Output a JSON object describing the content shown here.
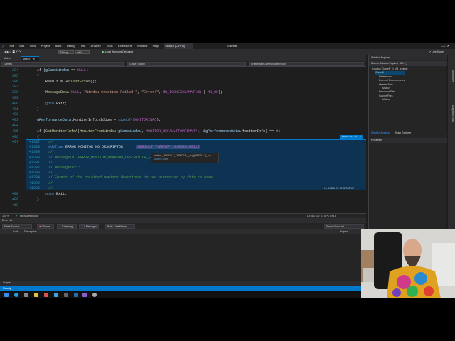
{
  "menu": {
    "items": [
      "File",
      "Edit",
      "View",
      "Project",
      "Build",
      "Debug",
      "Test",
      "Analyze",
      "Tools",
      "Extensions",
      "Window",
      "Help"
    ],
    "search": "Search (Ctrl+Q)",
    "solution_name": "GameB",
    "live_share": "Live Share"
  },
  "toolbar": {
    "config": "Debug",
    "platform": "x64",
    "debugger": "Local Windows Debugger"
  },
  "tabs": [
    {
      "label": "Main.h"
    },
    {
      "label": "Main.c"
    }
  ],
  "navbar": {
    "project": "GameB",
    "scope": "(Global Scope)",
    "function": "CreateMainGameWindow(void)"
  },
  "code_lines": [
    {
      "num": "394",
      "parts": [
        {
          "t": "if (",
          "c": ""
        },
        {
          "t": "gGameWindow",
          "c": "var"
        },
        {
          "t": " == ",
          "c": ""
        },
        {
          "t": "NULL",
          "c": "mac"
        },
        {
          "t": ")",
          "c": ""
        }
      ],
      "indent": 0
    },
    {
      "num": "395",
      "parts": [
        {
          "t": "{",
          "c": ""
        }
      ],
      "indent": 0
    },
    {
      "num": "396",
      "parts": [
        {
          "t": "Result = ",
          "c": ""
        },
        {
          "t": "GetLastError",
          "c": "fn"
        },
        {
          "t": "();",
          "c": ""
        }
      ],
      "indent": 1
    },
    {
      "num": "397",
      "parts": [],
      "indent": 1
    },
    {
      "num": "398",
      "parts": [
        {
          "t": "MessageBoxA",
          "c": "fn"
        },
        {
          "t": "(",
          "c": ""
        },
        {
          "t": "NULL",
          "c": "mac"
        },
        {
          "t": ", ",
          "c": ""
        },
        {
          "t": "\"Window Creation Failed!\"",
          "c": "str"
        },
        {
          "t": ", ",
          "c": ""
        },
        {
          "t": "\"Error!\"",
          "c": "str"
        },
        {
          "t": ", ",
          "c": ""
        },
        {
          "t": "MB_ICONEXCLAMATION",
          "c": "mac"
        },
        {
          "t": " | ",
          "c": ""
        },
        {
          "t": "MB_OK",
          "c": "mac"
        },
        {
          "t": ");",
          "c": ""
        }
      ],
      "indent": 1
    },
    {
      "num": "399",
      "parts": [],
      "indent": 1
    },
    {
      "num": "400",
      "parts": [
        {
          "t": "goto",
          "c": "kw"
        },
        {
          "t": " Exit;",
          "c": ""
        }
      ],
      "indent": 1
    },
    {
      "num": "401",
      "parts": [
        {
          "t": "}",
          "c": ""
        }
      ],
      "indent": 0
    },
    {
      "num": "402",
      "parts": [],
      "indent": 0
    },
    {
      "num": "403",
      "parts": [
        {
          "t": "gPerformanceData",
          "c": "var"
        },
        {
          "t": ".MonitorInfo.cbSize = ",
          "c": ""
        },
        {
          "t": "sizeof",
          "c": "kw"
        },
        {
          "t": "(",
          "c": ""
        },
        {
          "t": "MONITORINFO",
          "c": "mac"
        },
        {
          "t": ");",
          "c": ""
        }
      ],
      "indent": 0
    },
    {
      "num": "404",
      "parts": [],
      "indent": 0
    },
    {
      "num": "405",
      "parts": [
        {
          "t": "if (",
          "c": ""
        },
        {
          "t": "GetMonitorInfoA",
          "c": "fn"
        },
        {
          "t": "(",
          "c": ""
        },
        {
          "t": "MonitorFromWindow",
          "c": "fn"
        },
        {
          "t": "(",
          "c": ""
        },
        {
          "t": "gGameWindow",
          "c": "var"
        },
        {
          "t": ", ",
          "c": ""
        },
        {
          "t": "MONITOR_DEFAULTTOPRIMARY",
          "c": "mac"
        },
        {
          "t": "), &",
          "c": ""
        },
        {
          "t": "gPerformanceData",
          "c": "var"
        },
        {
          "t": ".MonitorInfo) == ",
          "c": ""
        },
        {
          "t": "0",
          "c": "num"
        },
        {
          "t": ")",
          "c": ""
        }
      ],
      "indent": 0
    },
    {
      "num": "406",
      "parts": [
        {
          "t": "{",
          "c": ""
        }
      ],
      "indent": 0
    },
    {
      "num": "407",
      "parts": [
        {
          "t": "Result = ",
          "c": ""
        },
        {
          "t": "ERROR_MONITOR_NO_DESCRIPTOR",
          "c": "mac"
        },
        {
          "t": ";",
          "c": ""
        }
      ],
      "indent": 1
    }
  ],
  "peek": {
    "title": "winerror.h",
    "lines": [
      {
        "num": "41387",
        "parts": [
          {
            "t": "//",
            "c": "cm"
          }
        ]
      },
      {
        "num": "41388",
        "parts": [
          {
            "t": "#define",
            "c": "kw"
          },
          {
            "t": " ERROR_MONITOR_NO_DESCRIPTOR      ",
            "c": ""
          },
          {
            "t": "_HRESULT_TYPEDEF_(0x80261001L)",
            "c": "mac"
          }
        ]
      },
      {
        "num": "41389",
        "parts": [
          {
            "t": "//",
            "c": "cm"
          }
        ]
      },
      {
        "num": "41390",
        "parts": [
          {
            "t": "// MessageId: ERROR_MONITOR_UNKNOWN_DESCRIPTOR_FORMAT",
            "c": "cm"
          }
        ]
      },
      {
        "num": "41391",
        "parts": [
          {
            "t": "//",
            "c": "cm"
          }
        ]
      },
      {
        "num": "41392",
        "parts": [
          {
            "t": "// MessageText:",
            "c": "cm"
          }
        ]
      },
      {
        "num": "41393",
        "parts": [
          {
            "t": "//",
            "c": "cm"
          }
        ]
      },
      {
        "num": "41394",
        "parts": [
          {
            "t": "// Format of the obtained monitor descriptor is not supported by this release.",
            "c": "cm"
          }
        ]
      },
      {
        "num": "41395",
        "parts": [
          {
            "t": "//",
            "c": "cm"
          }
        ]
      },
      {
        "num": "41396",
        "parts": [
          {
            "t": "//",
            "c": "cm"
          }
        ]
      }
    ],
    "tooltip_line1": "#define _HRESULT_TYPEDEF_(_sc) ((HRESULT)_sc)",
    "tooltip_line2": "Search Online"
  },
  "code_after": [
    {
      "num": "408",
      "parts": [
        {
          "t": "goto",
          "c": "kw"
        },
        {
          "t": " Exit;",
          "c": ""
        }
      ],
      "indent": 1
    },
    {
      "num": "409",
      "parts": [
        {
          "t": "}",
          "c": ""
        }
      ],
      "indent": 0
    },
    {
      "num": "410",
      "parts": [],
      "indent": 0
    }
  ],
  "editor_status": {
    "zoom": "100 %",
    "issues": "No issues found",
    "position": "Ln: 407  Ch: 27  SPC  CRLF",
    "peek_position": "Ln: 41388  Ch: 72  SPC  CRLF"
  },
  "error_list": {
    "title": "Error List",
    "scope": "Entire Solution",
    "errors": "0 Errors",
    "warnings": "0 Warnings",
    "messages": "0 Messages",
    "build": "Build + IntelliSense",
    "search": "Search Error List",
    "col_code": "Code",
    "col_desc": "Description",
    "col_project": "Project",
    "output_tab": "Output"
  },
  "solution_explorer": {
    "title": "Solution Explorer",
    "search": "Search Solution Explorer (Ctrl+;)",
    "items": [
      {
        "label": "Solution 'GameB' (1 of 1 project)",
        "depth": 0
      },
      {
        "label": "GameB",
        "depth": 1
      },
      {
        "label": "References",
        "depth": 2
      },
      {
        "label": "External Dependencies",
        "depth": 2
      },
      {
        "label": "Header Files",
        "depth": 2
      },
      {
        "label": "Main.h",
        "depth": 3
      },
      {
        "label": "Resource Files",
        "depth": 2
      },
      {
        "label": "Source Files",
        "depth": 2
      },
      {
        "label": "Main.c",
        "depth": 3
      }
    ],
    "bottom_tabs": [
      "Solution Explorer",
      "Team Explorer"
    ],
    "properties": "Properties"
  },
  "vertical_tabs": [
    "Notifications",
    "Diagnostic Tools"
  ],
  "statusbar": {
    "text": "Ready"
  }
}
